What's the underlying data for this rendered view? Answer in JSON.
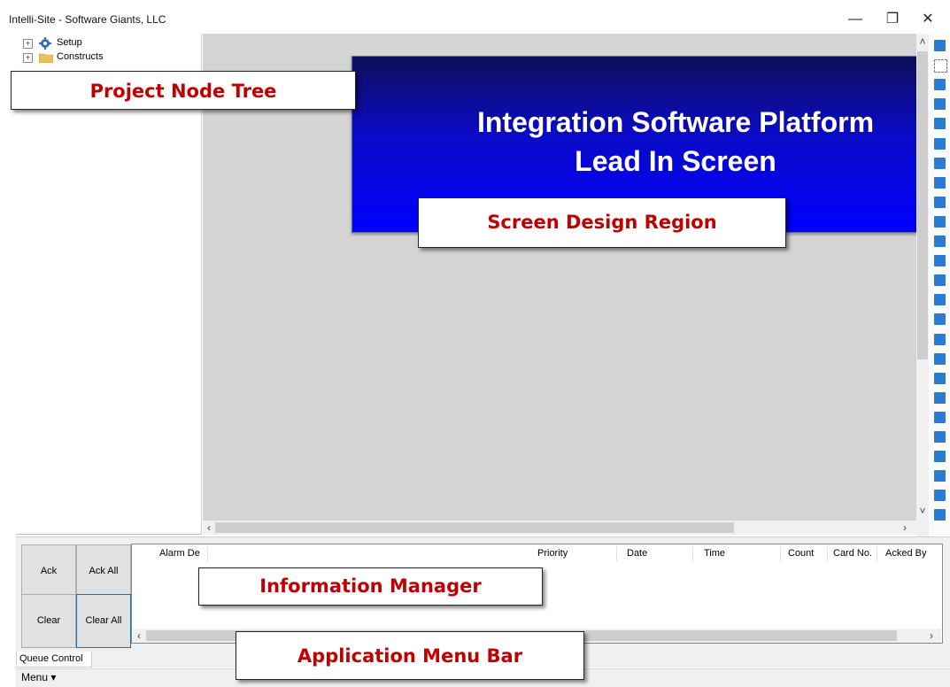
{
  "window": {
    "title": "Intelli-Site - Software Giants, LLC",
    "controls": {
      "minimize": "—",
      "restore": "❐",
      "close": "✕"
    }
  },
  "tree": {
    "items": [
      {
        "label": "Setup",
        "icon": "gear-icon"
      },
      {
        "label": "Constructs",
        "icon": "folder-icon"
      }
    ]
  },
  "design": {
    "banner_line1": "Integration Software Platform",
    "banner_line2": "Lead In Screen"
  },
  "toolbox": {
    "icons": [
      "back-arrow-icon",
      "select-rectangle-icon",
      "text-tool-icon",
      "fill-rectangle-icon",
      "rectangle-icon",
      "rounded-rectangle-icon",
      "ellipse-icon",
      "polygon-icon",
      "label-ab-icon",
      "textbox-ab-icon",
      "grid-icon",
      "image-list-icon",
      "chart-icon",
      "panel-icon",
      "window-icon",
      "align-left-icon",
      "align-right-icon",
      "align-top-icon",
      "align-bottom-icon",
      "align-center-icon",
      "align-middle-icon",
      "distribute-horizontal-icon",
      "distribute-vertical-icon",
      "same-size-icon",
      "same-width-icon"
    ]
  },
  "queue": {
    "buttons": {
      "ack": "Ack",
      "ack_all": "Ack All",
      "clear": "Clear",
      "clear_all": "Clear All"
    },
    "columns": [
      "Alarm De",
      "Priority",
      "Date",
      "Time",
      "Count",
      "Card No.",
      "Acked By"
    ]
  },
  "tabs": {
    "queue_control": "Queue Control"
  },
  "menubar": {
    "menu": "Menu ▾"
  },
  "callouts": {
    "project_node_tree": "Project Node Tree",
    "screen_design_region": "Screen Design Region",
    "information_manager": "Information Manager",
    "application_menu_bar": "Application Menu Bar"
  },
  "colors": {
    "callout_text": "#c00000",
    "banner_top": "#0f0f5a",
    "banner_bottom": "#0000ff",
    "toolbox_icon": "#2b7bd1"
  }
}
